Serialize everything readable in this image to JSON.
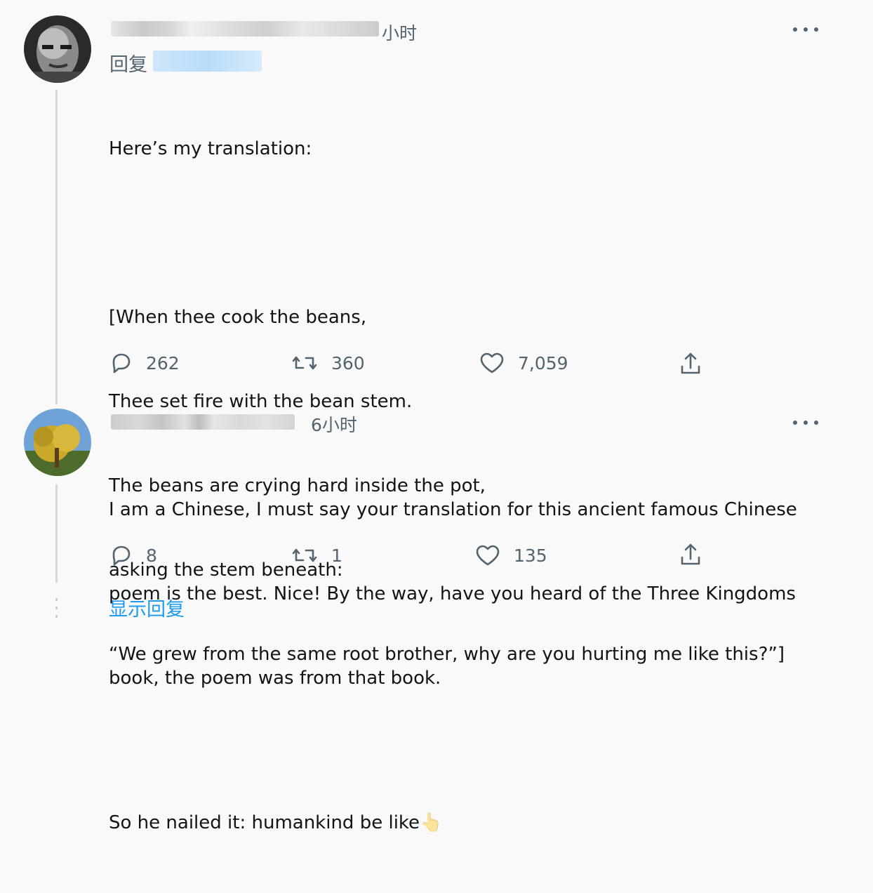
{
  "tweet1": {
    "time": "小时",
    "reply_prefix": "回复",
    "intro": "Here’s my translation:",
    "poem": [
      "[When thee cook the beans,",
      "Thee set fire with the bean stem.",
      "The beans are crying hard inside the pot,",
      "asking the stem beneath:",
      "“We grew from the same root brother, why are you hurting me like this?”]"
    ],
    "closing": "So he nailed it: humankind be like",
    "emoji": "👆",
    "counts": {
      "replies": "262",
      "retweets": "360",
      "likes": "7,059"
    }
  },
  "tweet2": {
    "time": "6小时",
    "lines": [
      "I am a Chinese, I must say your translation for this ancient famous Chinese",
      "poem is the best. Nice! By the way, have you heard of the Three Kingdoms",
      "book, the poem was from that book."
    ],
    "counts": {
      "replies": "8",
      "retweets": "1",
      "likes": "135"
    }
  },
  "show_replies_label": "显示回复",
  "icons": {
    "reply": "reply-icon",
    "retweet": "retweet-icon",
    "like": "heart-icon",
    "share": "share-icon",
    "more": "more-icon"
  },
  "colors": {
    "text": "#0f1419",
    "secondary": "#536471",
    "link": "#1d9bf0",
    "background": "#f9f9f9"
  }
}
